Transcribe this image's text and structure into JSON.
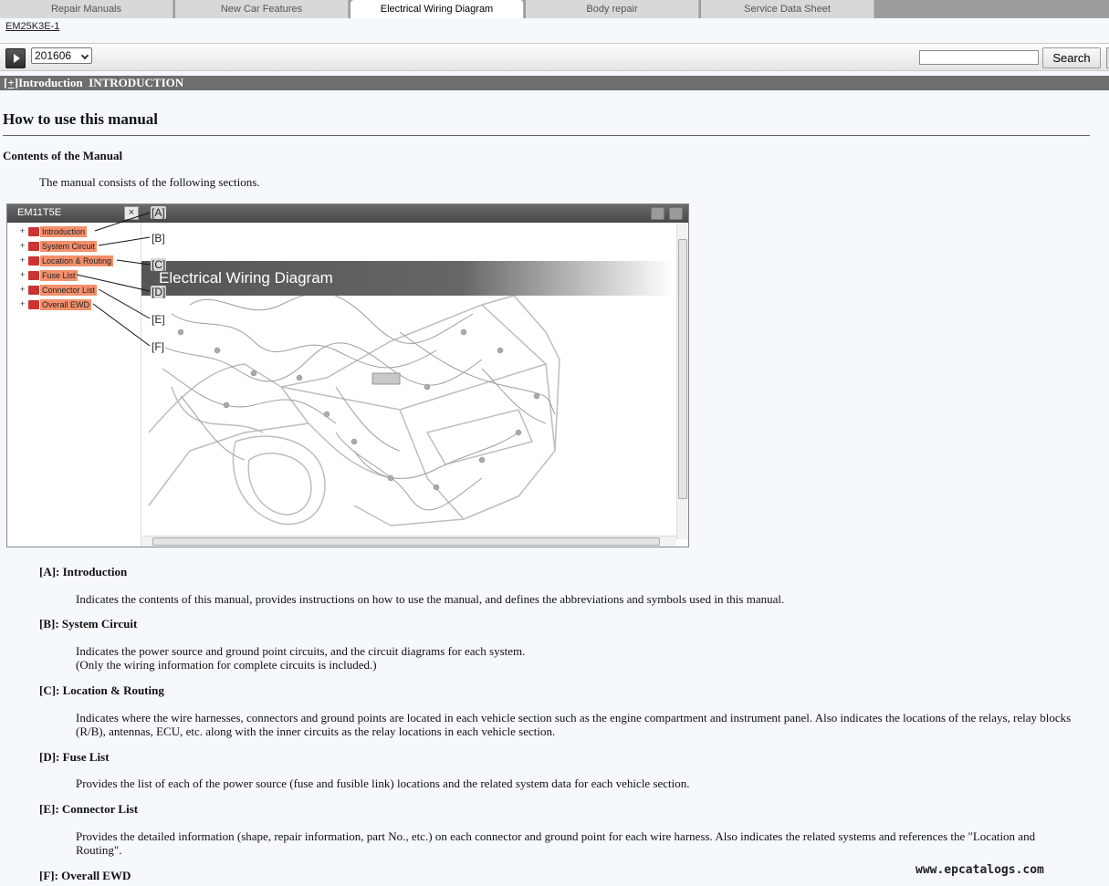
{
  "tabs": [
    {
      "label": "Repair Manuals",
      "active": false
    },
    {
      "label": "New Car Features",
      "active": false
    },
    {
      "label": "Electrical Wiring Diagram",
      "active": true
    },
    {
      "label": "Body repair",
      "active": false
    },
    {
      "label": "Service Data Sheet",
      "active": false
    }
  ],
  "doc_id": "EM25K3E-1",
  "toolbar": {
    "year_value": "201606",
    "search_placeholder": "",
    "search_label": "Search"
  },
  "section_bar": {
    "toggle": "[+]",
    "title": "Introduction  INTRODUCTION"
  },
  "page": {
    "title": "How to use this manual",
    "subtitle": "Contents of the Manual",
    "intro": "The manual consists of the following sections."
  },
  "figure": {
    "window_title": "EM11T5E",
    "close_glyph": "×",
    "banner": "Electrical Wiring Diagram",
    "tree": [
      {
        "label": "Introduction"
      },
      {
        "label": "System Circuit"
      },
      {
        "label": "Location & Routing"
      },
      {
        "label": "Fuse List"
      },
      {
        "label": "Connector List"
      },
      {
        "label": "Overall EWD"
      }
    ],
    "callouts": [
      "[A]",
      "[B]",
      "[C]",
      "[D]",
      "[E]",
      "[F]"
    ]
  },
  "sections": [
    {
      "term": "[A]: Introduction",
      "desc": [
        "Indicates the contents of this manual, provides instructions on how to use the manual, and defines the abbreviations and symbols used in this manual."
      ]
    },
    {
      "term": "[B]: System Circuit",
      "desc": [
        "Indicates the power source and ground point circuits, and the circuit diagrams for each system.",
        "(Only the wiring information for complete circuits is included.)"
      ]
    },
    {
      "term": "[C]: Location & Routing",
      "desc": [
        "Indicates where the wire harnesses, connectors and ground points are located in each vehicle section such as the engine compartment and instrument panel. Also indicates the locations of the relays, relay blocks (R/B), antennas, ECU, etc. along with the inner circuits as the relay locations in each vehicle section."
      ]
    },
    {
      "term": "[D]: Fuse List",
      "desc": [
        "Provides the list of each of the power source (fuse and fusible link) locations and the related system data for each vehicle section."
      ]
    },
    {
      "term": "[E]: Connector List",
      "desc": [
        "Provides the detailed information (shape, repair information, part No., etc.) on each connector and ground point for each wire harness. Also indicates the related systems and references the \"Location and Routing\"."
      ]
    },
    {
      "term": "[F]: Overall EWD",
      "desc": []
    }
  ],
  "watermark": "www.epcatalogs.com"
}
